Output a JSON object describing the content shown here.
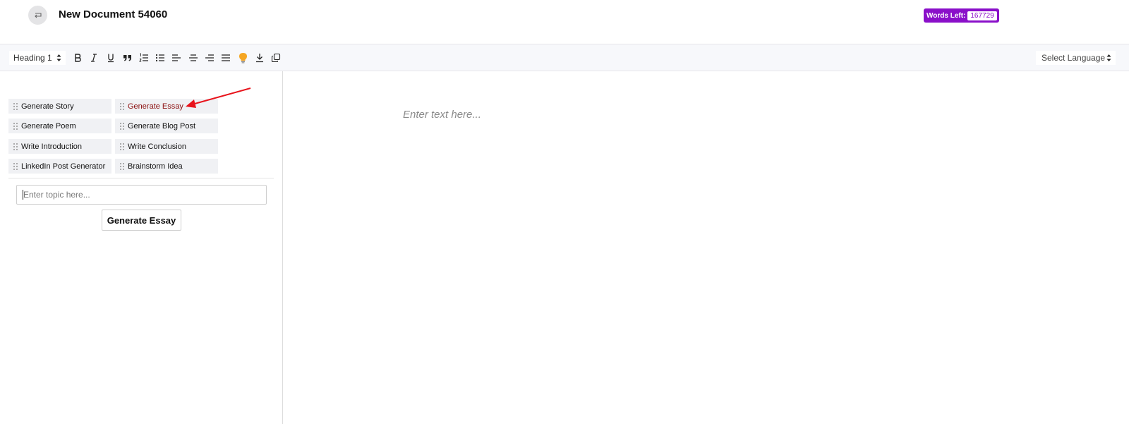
{
  "header": {
    "title": "New Document 54060",
    "back_icon": "return-arrow-icon",
    "words_left_label": "Words Left:",
    "words_left_count": "167729",
    "badge_color": "#8a0fc9"
  },
  "toolbar": {
    "heading_select_value": "Heading 1",
    "language_select_value": "Select Language",
    "tools": [
      "bold-icon",
      "italic-icon",
      "underline-icon",
      "quote-icon",
      "ordered-list-icon",
      "bullet-list-icon",
      "align-left-icon",
      "align-center-icon",
      "align-right-icon",
      "align-justify-icon",
      "lightbulb-icon",
      "download-icon",
      "copy-icon"
    ],
    "bulb_color": "#f5a623"
  },
  "sidebar": {
    "items": [
      {
        "label": "Generate Story"
      },
      {
        "label": "Generate Essay",
        "active": true
      },
      {
        "label": "Generate Poem"
      },
      {
        "label": "Generate Blog Post"
      },
      {
        "label": "Write Introduction"
      },
      {
        "label": "Write Conclusion"
      },
      {
        "label": "LinkedIn Post Generator"
      },
      {
        "label": "Brainstorm Idea"
      }
    ],
    "topic_placeholder": "Enter topic here...",
    "generate_button_label": "Generate Essay",
    "active_color": "#8b0f0f"
  },
  "editor": {
    "placeholder": "Enter text here..."
  },
  "annotation": {
    "arrow_color": "#e8141c"
  }
}
